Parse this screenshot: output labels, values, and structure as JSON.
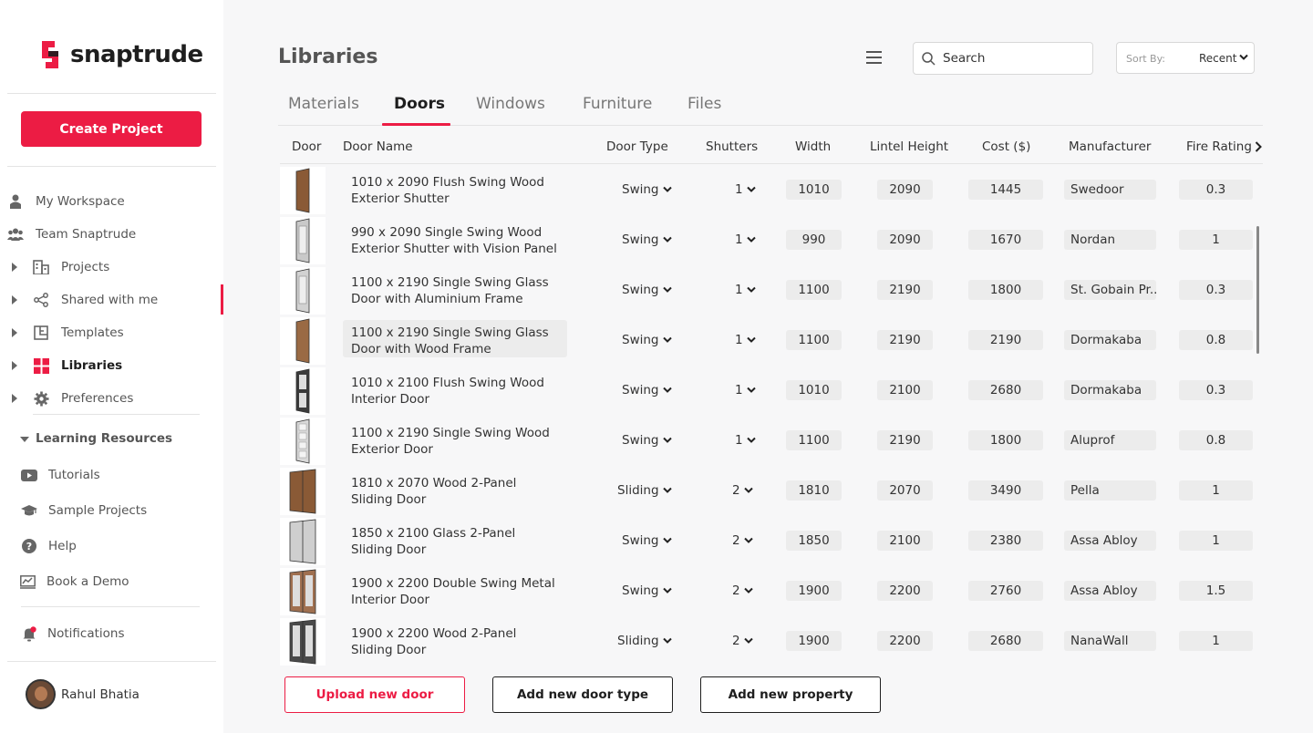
{
  "brand": {
    "name": "snaptrude",
    "accent": "#ec1c44"
  },
  "sidebar": {
    "create_label": "Create Project",
    "items": [
      {
        "label": "My Workspace",
        "icon": "person-icon"
      },
      {
        "label": "Team Snaptrude",
        "icon": "team-icon"
      },
      {
        "label": "Projects",
        "icon": "building-icon"
      },
      {
        "label": "Shared with me",
        "icon": "share-icon"
      },
      {
        "label": "Templates",
        "icon": "template-icon"
      },
      {
        "label": "Libraries",
        "icon": "grid-icon"
      },
      {
        "label": "Preferences",
        "icon": "gear-icon"
      }
    ],
    "learning_title": "Learning Resources",
    "learning": [
      {
        "label": "Tutorials",
        "icon": "youtube-icon"
      },
      {
        "label": "Sample Projects",
        "icon": "graduation-cap-icon"
      },
      {
        "label": "Help",
        "icon": "help-icon"
      },
      {
        "label": "Book a Demo",
        "icon": "chart-icon"
      }
    ],
    "notifications": "Notifications",
    "user_name": "Rahul Bhatia"
  },
  "header": {
    "title": "Libraries",
    "search_placeholder": "Search",
    "sort_label": "Sort By:",
    "sort_value": "Recent"
  },
  "tabs": [
    "Materials",
    "Doors",
    "Windows",
    "Furniture",
    "Files"
  ],
  "columns": [
    "Door",
    "Door Name",
    "Door Type",
    "Shutters",
    "Width",
    "Lintel Height",
    "Cost ($)",
    "Manufacturer",
    "Fire Rating"
  ],
  "rows": [
    {
      "name": "1010 x 2090 Flush Swing Wood Exterior Shutter",
      "type": "Swing",
      "shutters": "1",
      "width": "1010",
      "lintel": "2090",
      "cost": "1445",
      "manufacturer": "Swedoor",
      "fire": "0.3"
    },
    {
      "name": "990 x 2090 Single Swing Wood Exterior Shutter with Vision Panel",
      "type": "Swing",
      "shutters": "1",
      "width": "990",
      "lintel": "2090",
      "cost": "1670",
      "manufacturer": "Nordan",
      "fire": "1"
    },
    {
      "name": "1100 x 2190 Single Swing Glass Door with Aluminium Frame",
      "type": "Swing",
      "shutters": "1",
      "width": "1100",
      "lintel": "2190",
      "cost": "1800",
      "manufacturer": "St. Gobain Pr...",
      "fire": "0.3"
    },
    {
      "name": "1100 x 2190 Single Swing Glass Door with Wood Frame",
      "type": "Swing",
      "shutters": "1",
      "width": "1100",
      "lintel": "2190",
      "cost": "2190",
      "manufacturer": "Dormakaba",
      "fire": "0.8"
    },
    {
      "name": "1010 x 2100 Flush Swing Wood Interior Door",
      "type": "Swing",
      "shutters": "1",
      "width": "1010",
      "lintel": "2100",
      "cost": "2680",
      "manufacturer": "Dormakaba",
      "fire": "0.3"
    },
    {
      "name": "1100 x 2190 Single Swing Wood Exterior Door",
      "type": "Swing",
      "shutters": "1",
      "width": "1100",
      "lintel": "2190",
      "cost": "1800",
      "manufacturer": "Aluprof",
      "fire": "0.8"
    },
    {
      "name": "1810 x 2070 Wood 2-Panel Sliding Door",
      "type": "Sliding",
      "shutters": "2",
      "width": "1810",
      "lintel": "2070",
      "cost": "3490",
      "manufacturer": "Pella",
      "fire": "1"
    },
    {
      "name": "1850 x 2100 Glass 2-Panel Sliding Door",
      "type": "Swing",
      "shutters": "2",
      "width": "1850",
      "lintel": "2100",
      "cost": "2380",
      "manufacturer": "Assa Abloy",
      "fire": "1"
    },
    {
      "name": "1900 x 2200 Double Swing Metal Interior Door",
      "type": "Swing",
      "shutters": "2",
      "width": "1900",
      "lintel": "2200",
      "cost": "2760",
      "manufacturer": "Assa Abloy",
      "fire": "1.5"
    },
    {
      "name": "1900 x 2200 Wood 2-Panel Sliding Door",
      "type": "Sliding",
      "shutters": "2",
      "width": "1900",
      "lintel": "2200",
      "cost": "2680",
      "manufacturer": "NanaWall",
      "fire": "1"
    }
  ],
  "actions": {
    "upload": "Upload new door",
    "add_type": "Add new door type",
    "add_property": "Add new property"
  }
}
